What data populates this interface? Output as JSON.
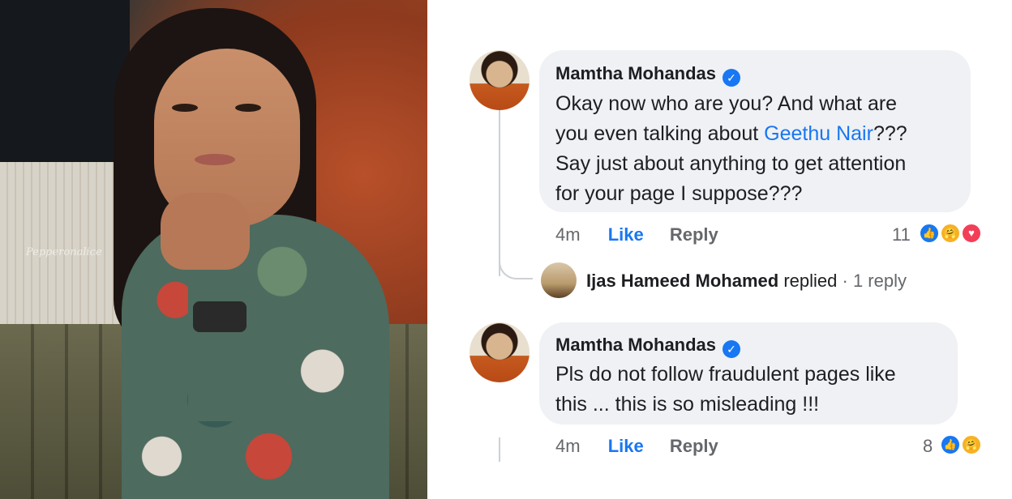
{
  "photo": {
    "watermark": "Pepperonalice",
    "description_icon": "person-photo"
  },
  "comments": [
    {
      "author": "Mamtha Mohandas",
      "verified_icon": "verified-badge-icon",
      "text_before_link": "Okay now who are you? And what are you even talking about ",
      "link": "Geethu Nair",
      "text_after_link": "??? Say just about anything to get attention for your page I suppose???",
      "lines": [
        "Okay now who are you? And what are",
        "you even talking about ",
        "Geethu Nair",
        "???",
        "Say just about anything to get attention",
        "for your page I suppose???"
      ],
      "time": "4m",
      "like_label": "Like",
      "reply_label": "Reply",
      "reaction_count": "11",
      "reactions": [
        "like",
        "care",
        "love"
      ]
    },
    {
      "author": "Mamtha Mohandas",
      "verified_icon": "verified-badge-icon",
      "lines": [
        "Pls do not follow fraudulent pages like",
        "this ... this is so misleading !!!"
      ],
      "time": "4m",
      "like_label": "Like",
      "reply_label": "Reply",
      "reaction_count": "8",
      "reactions": [
        "like",
        "care"
      ]
    }
  ],
  "reply_summary": {
    "name": "Ijas Hameed Mohamed",
    "action": "replied",
    "separator": "·",
    "count": "1 reply"
  },
  "colors": {
    "accent": "#1877f2",
    "bubble": "#eff1f4",
    "meta": "#65676b",
    "text": "#1c1e21"
  }
}
